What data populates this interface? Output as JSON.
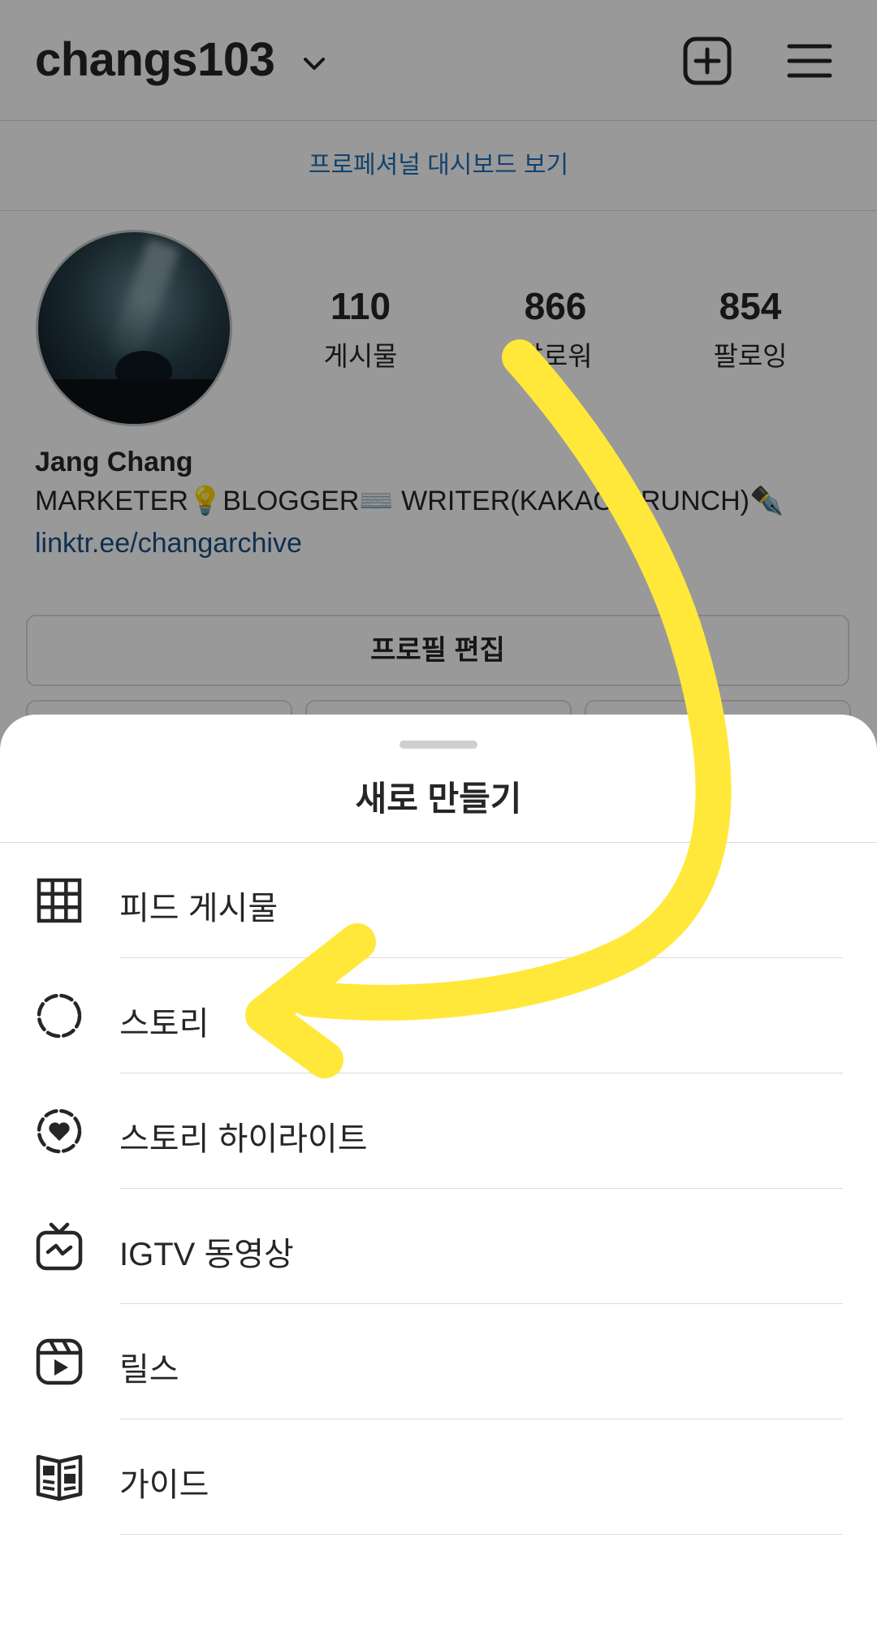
{
  "header": {
    "username": "changs103"
  },
  "professional_bar": {
    "text": "프로페셔널 대시보드 보기"
  },
  "profile": {
    "stats": [
      {
        "value": "110",
        "label": "게시물"
      },
      {
        "value": "866",
        "label": "팔로워"
      },
      {
        "value": "854",
        "label": "팔로잉"
      }
    ],
    "name": "Jang Chang",
    "bio": "MARKETER💡BLOGGER⌨️ WRITER(KAKAO BRUNCH)✒️",
    "link": "linktr.ee/changarchive",
    "edit_button": "프로필 편집"
  },
  "sheet": {
    "title": "새로 만들기",
    "items": [
      {
        "label": "피드 게시물",
        "icon": "grid-icon"
      },
      {
        "label": "스토리",
        "icon": "story-icon"
      },
      {
        "label": "스토리 하이라이트",
        "icon": "highlight-heart-icon"
      },
      {
        "label": "IGTV 동영상",
        "icon": "igtv-icon"
      },
      {
        "label": "릴스",
        "icon": "reels-icon"
      },
      {
        "label": "가이드",
        "icon": "guide-icon"
      }
    ]
  },
  "colors": {
    "link_blue": "#1a4f86",
    "pro_bar_blue": "#1f6fb5",
    "annotation_yellow": "#ffe83a",
    "overlay": "rgba(0,0,0,0.40)"
  }
}
